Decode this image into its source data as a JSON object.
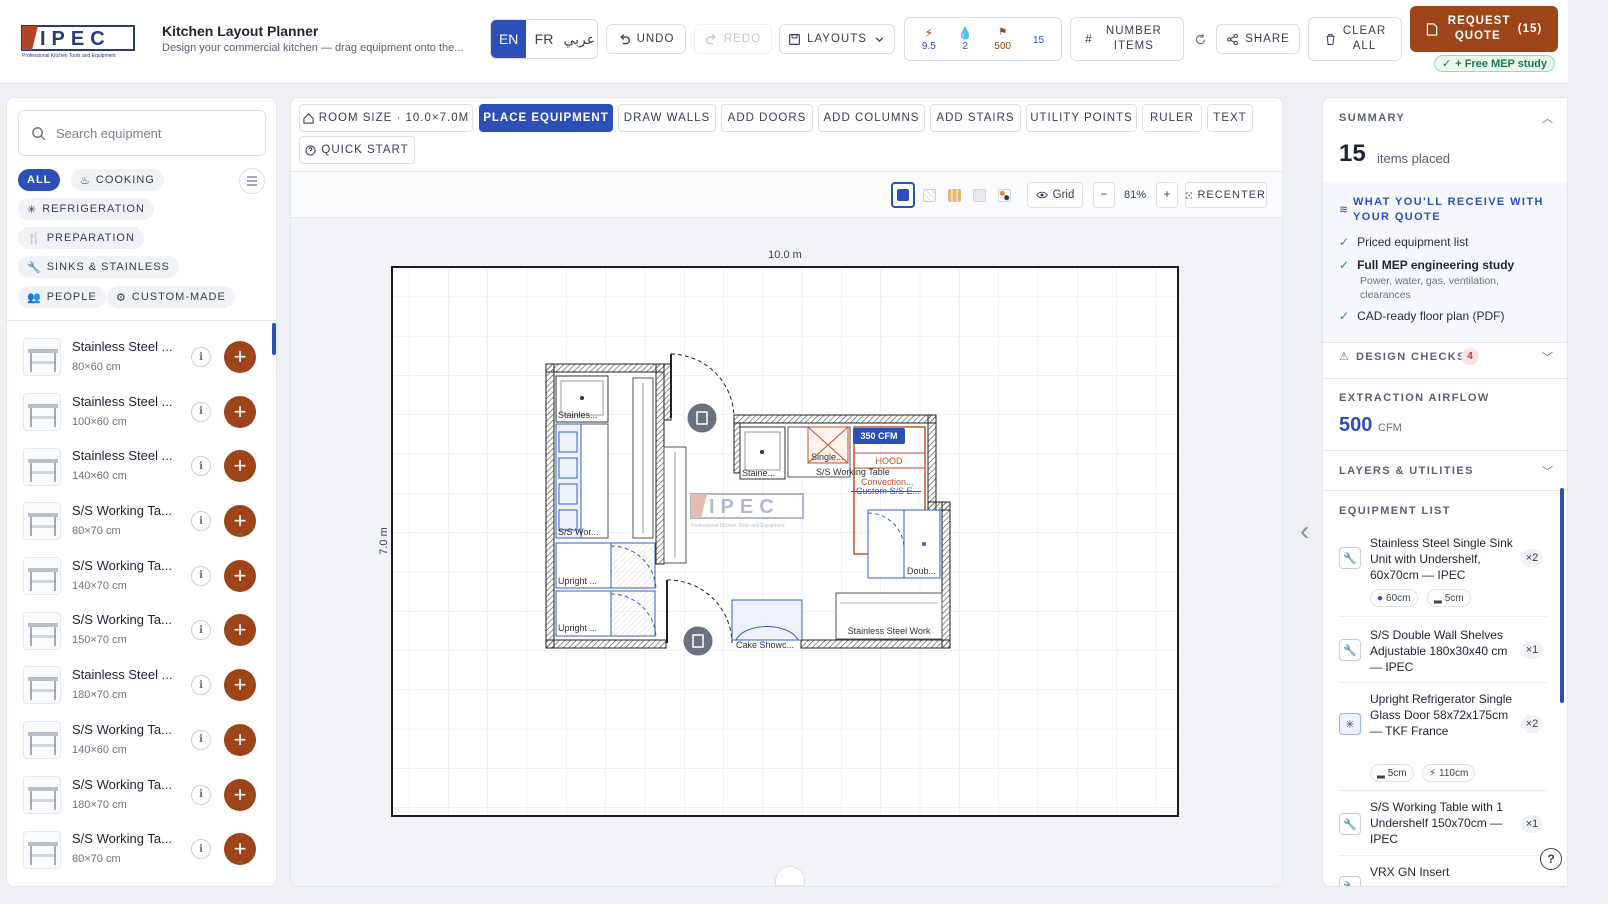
{
  "header": {
    "logo_text": "IPEC",
    "logo_tagline": "Professional Kitchen Tools and Equipment",
    "title": "Kitchen Layout Planner",
    "subtitle": "Design your commercial kitchen — drag equipment onto the...",
    "languages": [
      "EN",
      "FR",
      "عربي"
    ],
    "active_language": "EN",
    "undo": "UNDO",
    "redo": "REDO",
    "layouts": "LAYOUTS",
    "stats": {
      "power": "9.5",
      "water": "2",
      "airflow": "500",
      "items": "15"
    },
    "number_items": "NUMBER ITEMS",
    "share": "SHARE",
    "clear_all": "CLEAR ALL",
    "request_quote": "REQUEST QUOTE",
    "quote_count": "(15)",
    "mep_badge": "+ Free MEP study"
  },
  "left_panel": {
    "search_placeholder": "Search equipment",
    "categories": [
      {
        "label": "ALL",
        "icon": "none",
        "active": true
      },
      {
        "label": "COOKING",
        "icon": "flame-icon",
        "active": false
      },
      {
        "label": "REFRIGERATION",
        "icon": "snowflake-icon",
        "active": false
      },
      {
        "label": "PREPARATION",
        "icon": "utensils-icon",
        "active": false
      },
      {
        "label": "SINKS & STAINLESS",
        "icon": "wrench-icon",
        "active": false
      },
      {
        "label": "PEOPLE",
        "icon": "people-icon",
        "active": false
      },
      {
        "label": "CUSTOM-MADE",
        "icon": "gear-icon",
        "active": false
      }
    ],
    "items": [
      {
        "name": "Stainless Steel ...",
        "size": "80×60 cm"
      },
      {
        "name": "Stainless Steel ...",
        "size": "100×60 cm"
      },
      {
        "name": "Stainless Steel ...",
        "size": "140×60 cm"
      },
      {
        "name": "S/S Working Ta...",
        "size": "80×70 cm"
      },
      {
        "name": "S/S Working Ta...",
        "size": "140×70 cm"
      },
      {
        "name": "S/S Working Ta...",
        "size": "150×70 cm"
      },
      {
        "name": "Stainless Steel ...",
        "size": "180×70 cm"
      },
      {
        "name": "S/S Working Ta...",
        "size": "140×60 cm"
      },
      {
        "name": "S/S Working Ta...",
        "size": "180×70 cm"
      },
      {
        "name": "S/S Working Ta...",
        "size": "80×70 cm"
      }
    ]
  },
  "toolbar": {
    "room_size": "ROOM SIZE · 10.0×7.0M",
    "tools": [
      "PLACE EQUIPMENT",
      "DRAW WALLS",
      "ADD DOORS",
      "ADD COLUMNS",
      "ADD STAIRS",
      "UTILITY POINTS",
      "RULER",
      "TEXT"
    ],
    "active_tool": "PLACE EQUIPMENT",
    "quick_start": "QUICK START",
    "grid": "Grid",
    "zoom": "81%",
    "recenter": "RECENTER"
  },
  "canvas": {
    "width_label": "10.0 m",
    "height_label": "7.0 m",
    "hood_badge": "350 CFM",
    "labels": {
      "stainless_1": "Stainles...",
      "sw_wor": "S/S Wor...",
      "upright_1": "Upright ...",
      "upright_2": "Upright ...",
      "staine": "Staine...",
      "single": "Single...",
      "ss_working_table": "S/S Working Table",
      "hood": "HOOD",
      "convection": "Convection...",
      "custom_ss": "Custom S/S E...",
      "doub": "Doub...",
      "cake": "Cake Showc...",
      "ss_work": "Stainless Steel Work"
    }
  },
  "summary": {
    "heading": "SUMMARY",
    "count": "15",
    "count_label": "items placed",
    "receive_heading": "WHAT YOU'LL RECEIVE WITH YOUR QUOTE",
    "receive_items": [
      {
        "title": "Priced equipment list",
        "bold": false,
        "sub": ""
      },
      {
        "title": "Full MEP engineering study",
        "bold": true,
        "sub": "Power, water, gas, ventilation, clearances"
      },
      {
        "title": "CAD-ready floor plan (PDF)",
        "bold": false,
        "sub": ""
      }
    ],
    "design_checks": "DESIGN CHECKS",
    "design_checks_count": "4",
    "airflow_heading": "EXTRACTION AIRFLOW",
    "airflow_value": "500",
    "airflow_unit": "CFM",
    "layers_heading": "LAYERS & UTILITIES",
    "equipment_heading": "EQUIPMENT LIST",
    "equipment": [
      {
        "name": "Stainless Steel Single Sink Unit with Undershelf, 60x70cm — IPEC",
        "qty": "×2",
        "icon": "wrench-icon",
        "tags": [
          "60cm",
          "5cm"
        ]
      },
      {
        "name": "S/S Double Wall Shelves Adjustable 180x30x40 cm — IPEC",
        "qty": "×1",
        "icon": "wrench-icon",
        "tags": []
      },
      {
        "name": "Upright Refrigerator Single Glass Door 58x72x175cm — TKF France",
        "qty": "×2",
        "icon": "snowflake-icon",
        "tags": [
          "5cm",
          "110cm"
        ]
      },
      {
        "name": "S/S Working Table with 1 Undershelf 150x70cm — IPEC",
        "qty": "×1",
        "icon": "wrench-icon",
        "tags": []
      },
      {
        "name": "VRX GN Insert",
        "qty": "",
        "icon": "wrench-icon",
        "tags": []
      }
    ]
  },
  "colors": {
    "accent": "#2d4fb8",
    "brand": "#9d4518",
    "success": "#1f9a55"
  }
}
